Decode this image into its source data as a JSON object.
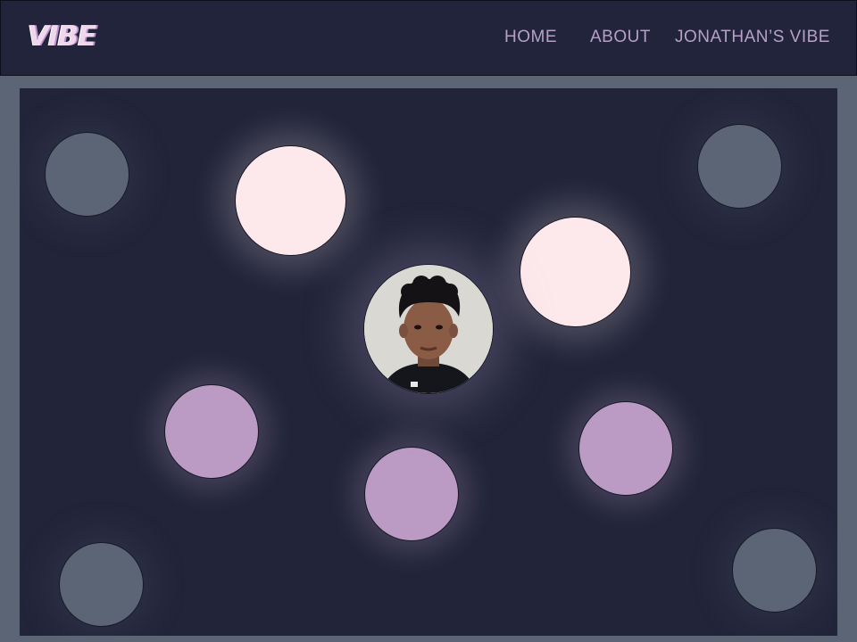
{
  "brand": {
    "logo_text": "VIBE"
  },
  "nav": {
    "home": "HOME",
    "about": "ABOUT",
    "vibe": "JONATHAN’S VIBE"
  },
  "colors": {
    "page_frame": "#5b6575",
    "header_bg": "#21243a",
    "stage_bg": "#22253a",
    "nav_text": "#b7a0c8",
    "orb_slate": "#5b6575",
    "orb_cream": "#fde9ec",
    "orb_lilac": "#bb9bc3"
  },
  "icons": {
    "avatar": "profile-photo"
  }
}
